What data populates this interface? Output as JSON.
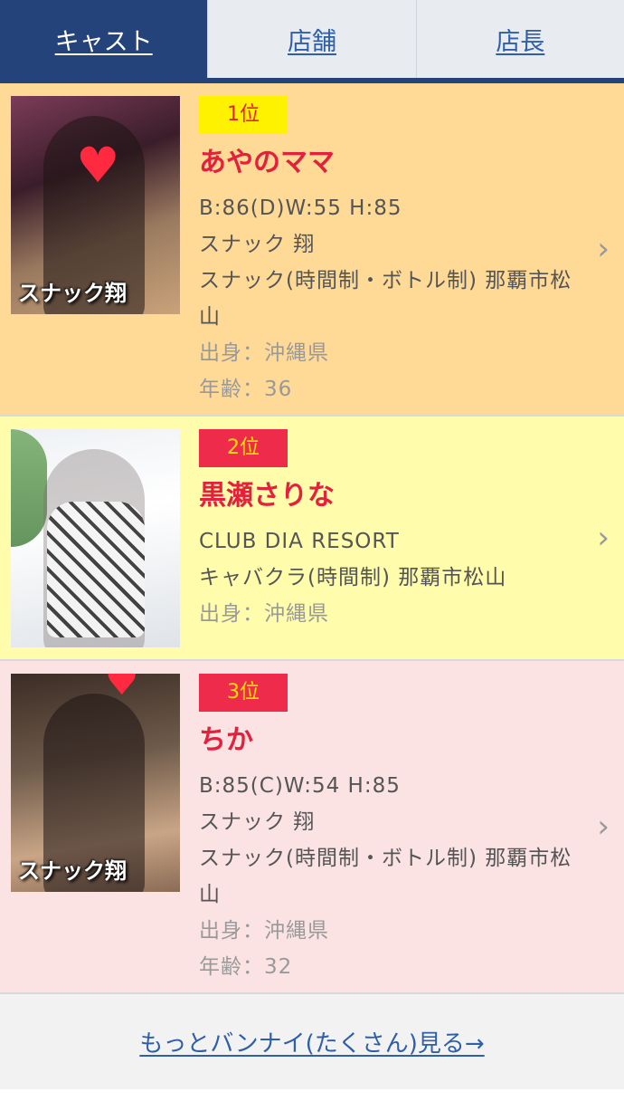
{
  "tabs": [
    {
      "label": "キャスト",
      "active": true
    },
    {
      "label": "店舗",
      "active": false
    },
    {
      "label": "店長",
      "active": false
    }
  ],
  "photo_logo": "スナック翔",
  "cards": [
    {
      "rank": "1位",
      "name": "あやのママ",
      "lines": [
        "B:86(D)W:55 H:85",
        "スナック 翔",
        "スナック(時間制・ボトル制) 那覇市松山"
      ],
      "muted": [
        "出身：沖縄県",
        "年齢：36"
      ],
      "background": "#ffd996"
    },
    {
      "rank": "2位",
      "name": "黒瀬さりな",
      "lines": [
        "CLUB DIA RESORT",
        "キャバクラ(時間制) 那覇市松山"
      ],
      "muted": [
        "出身：沖縄県"
      ],
      "background": "#fffcab"
    },
    {
      "rank": "3位",
      "name": "ちか",
      "lines": [
        "B:85(C)W:54 H:85",
        "スナック 翔",
        "スナック(時間制・ボトル制) 那覇市松山"
      ],
      "muted": [
        "出身：沖縄県",
        "年齢：32"
      ],
      "background": "#fbe3e3"
    }
  ],
  "more_link": "もっとバンナイ(たくさん)見る→",
  "colors": {
    "nav_active": "#23437a",
    "link": "#2e5fa8",
    "name_red": "#e3213d",
    "rank_yellow": "#fff200",
    "rank_red": "#ee2b4a"
  }
}
